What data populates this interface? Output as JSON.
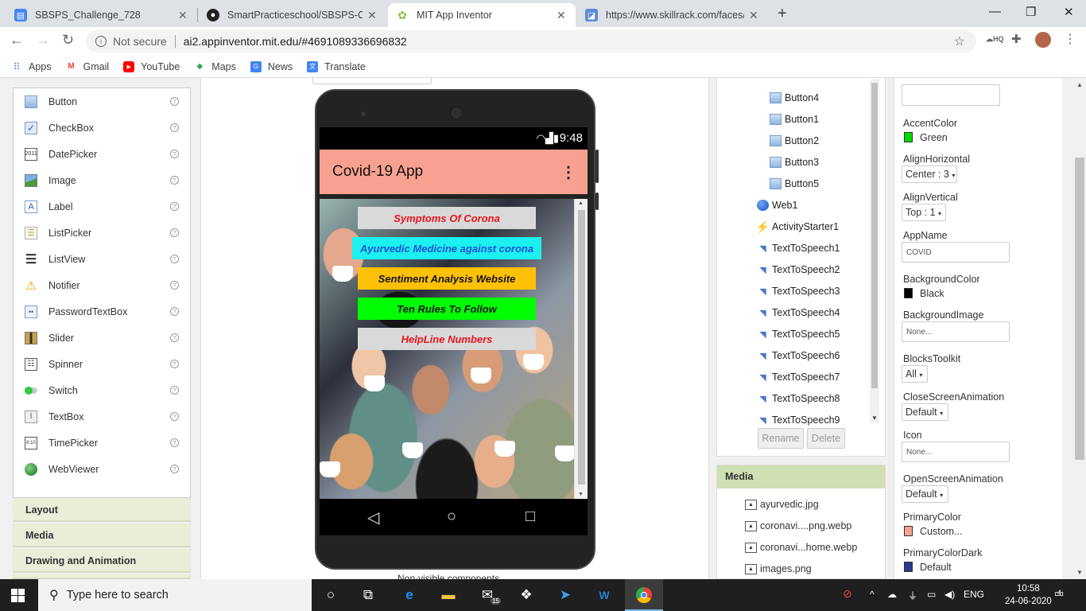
{
  "browser": {
    "tabs": [
      {
        "title": "SBSPS_Challenge_728",
        "icon": "document-icon"
      },
      {
        "title": "SmartPracticeschool/SBSPS-Chall",
        "icon": "github-icon"
      },
      {
        "title": "MIT App Inventor",
        "icon": "appinventor-icon"
      },
      {
        "title": "https://www.skillrack.com/faces/",
        "icon": "skillrack-icon"
      }
    ],
    "security_label": "Not secure",
    "url": "ai2.appinventor.mit.edu/#4691089336696832",
    "bookmarks": [
      "Apps",
      "Gmail",
      "YouTube",
      "Maps",
      "News",
      "Translate"
    ]
  },
  "palette": {
    "items": [
      {
        "label": "Button",
        "icon": "button-icon"
      },
      {
        "label": "CheckBox",
        "icon": "checkbox-icon"
      },
      {
        "label": "DatePicker",
        "icon": "datepicker-icon",
        "glyph": "2011"
      },
      {
        "label": "Image",
        "icon": "image-icon"
      },
      {
        "label": "Label",
        "icon": "label-icon",
        "glyph": "A"
      },
      {
        "label": "ListPicker",
        "icon": "listpicker-icon"
      },
      {
        "label": "ListView",
        "icon": "listview-icon"
      },
      {
        "label": "Notifier",
        "icon": "notifier-icon"
      },
      {
        "label": "PasswordTextBox",
        "icon": "password-icon",
        "glyph": "••"
      },
      {
        "label": "Slider",
        "icon": "slider-icon"
      },
      {
        "label": "Spinner",
        "icon": "spinner-icon"
      },
      {
        "label": "Switch",
        "icon": "switch-icon"
      },
      {
        "label": "TextBox",
        "icon": "textbox-icon",
        "glyph": "I"
      },
      {
        "label": "TimePicker",
        "icon": "timepicker-icon",
        "glyph": "8:10"
      },
      {
        "label": "WebViewer",
        "icon": "webviewer-icon"
      }
    ],
    "help_glyph": "?",
    "sections": [
      "Layout",
      "Media",
      "Drawing and Animation"
    ]
  },
  "phone": {
    "time": "9:48",
    "app_title": "Covid-19 App",
    "buttons": [
      {
        "label": "Symptoms Of Corona",
        "bg": "#d9d9d9",
        "color": "#e8141e"
      },
      {
        "label": "Ayurvedic Medicine against corona",
        "bg": "#1cf0f0",
        "color": "#1f52d6"
      },
      {
        "label": "Sentiment Analysis Website",
        "bg": "#ffc107",
        "color": "#111111"
      },
      {
        "label": "Ten Rules To Follow",
        "bg": "#00ff00",
        "color": "#111111"
      },
      {
        "label": "HelpLine Numbers",
        "bg": "#d9d9d9",
        "color": "#e8141e"
      }
    ],
    "titlebar_color": "#f8a191"
  },
  "nonvisible_label": "Non-visible components",
  "components": {
    "items": [
      {
        "label": "Button4",
        "icon": "button-icon"
      },
      {
        "label": "Button1",
        "icon": "button-icon"
      },
      {
        "label": "Button2",
        "icon": "button-icon"
      },
      {
        "label": "Button3",
        "icon": "button-icon"
      },
      {
        "label": "Button5",
        "icon": "button-icon"
      },
      {
        "label": "Web1",
        "icon": "globe-icon"
      },
      {
        "label": "ActivityStarter1",
        "icon": "lightning-icon"
      },
      {
        "label": "TextToSpeech1",
        "icon": "speech-icon"
      },
      {
        "label": "TextToSpeech2",
        "icon": "speech-icon"
      },
      {
        "label": "TextToSpeech3",
        "icon": "speech-icon"
      },
      {
        "label": "TextToSpeech4",
        "icon": "speech-icon"
      },
      {
        "label": "TextToSpeech5",
        "icon": "speech-icon"
      },
      {
        "label": "TextToSpeech6",
        "icon": "speech-icon"
      },
      {
        "label": "TextToSpeech7",
        "icon": "speech-icon"
      },
      {
        "label": "TextToSpeech8",
        "icon": "speech-icon"
      },
      {
        "label": "TextToSpeech9",
        "icon": "speech-icon"
      }
    ],
    "rename_label": "Rename",
    "delete_label": "Delete"
  },
  "media": {
    "heading": "Media",
    "files": [
      "ayurvedic.jpg",
      "coronavi....png.webp",
      "coronavi...home.webp",
      "images.png"
    ]
  },
  "properties": {
    "accent_color": {
      "label": "AccentColor",
      "value": "Green",
      "swatch": "#00dd00"
    },
    "align_horizontal": {
      "label": "AlignHorizontal",
      "value": "Center : 3"
    },
    "align_vertical": {
      "label": "AlignVertical",
      "value": "Top : 1"
    },
    "app_name": {
      "label": "AppName",
      "value": "COVID"
    },
    "background_color": {
      "label": "BackgroundColor",
      "value": "Black",
      "swatch": "#000000"
    },
    "background_image": {
      "label": "BackgroundImage",
      "value": "None..."
    },
    "blocks_toolkit": {
      "label": "BlocksToolkit",
      "value": "All"
    },
    "close_screen_animation": {
      "label": "CloseScreenAnimation",
      "value": "Default"
    },
    "icon": {
      "label": "Icon",
      "value": "None..."
    },
    "open_screen_animation": {
      "label": "OpenScreenAnimation",
      "value": "Default"
    },
    "primary_color": {
      "label": "PrimaryColor",
      "value": "Custom...",
      "swatch": "#f8a191"
    },
    "primary_color_dark": {
      "label": "PrimaryColorDark",
      "value": "Default",
      "swatch": "#2a3a8f"
    }
  },
  "taskbar": {
    "search_placeholder": "Type here to search",
    "mail_badge": "15",
    "language": "ENG",
    "time": "10:58",
    "date": "24-06-2020",
    "notification_count": "4"
  }
}
